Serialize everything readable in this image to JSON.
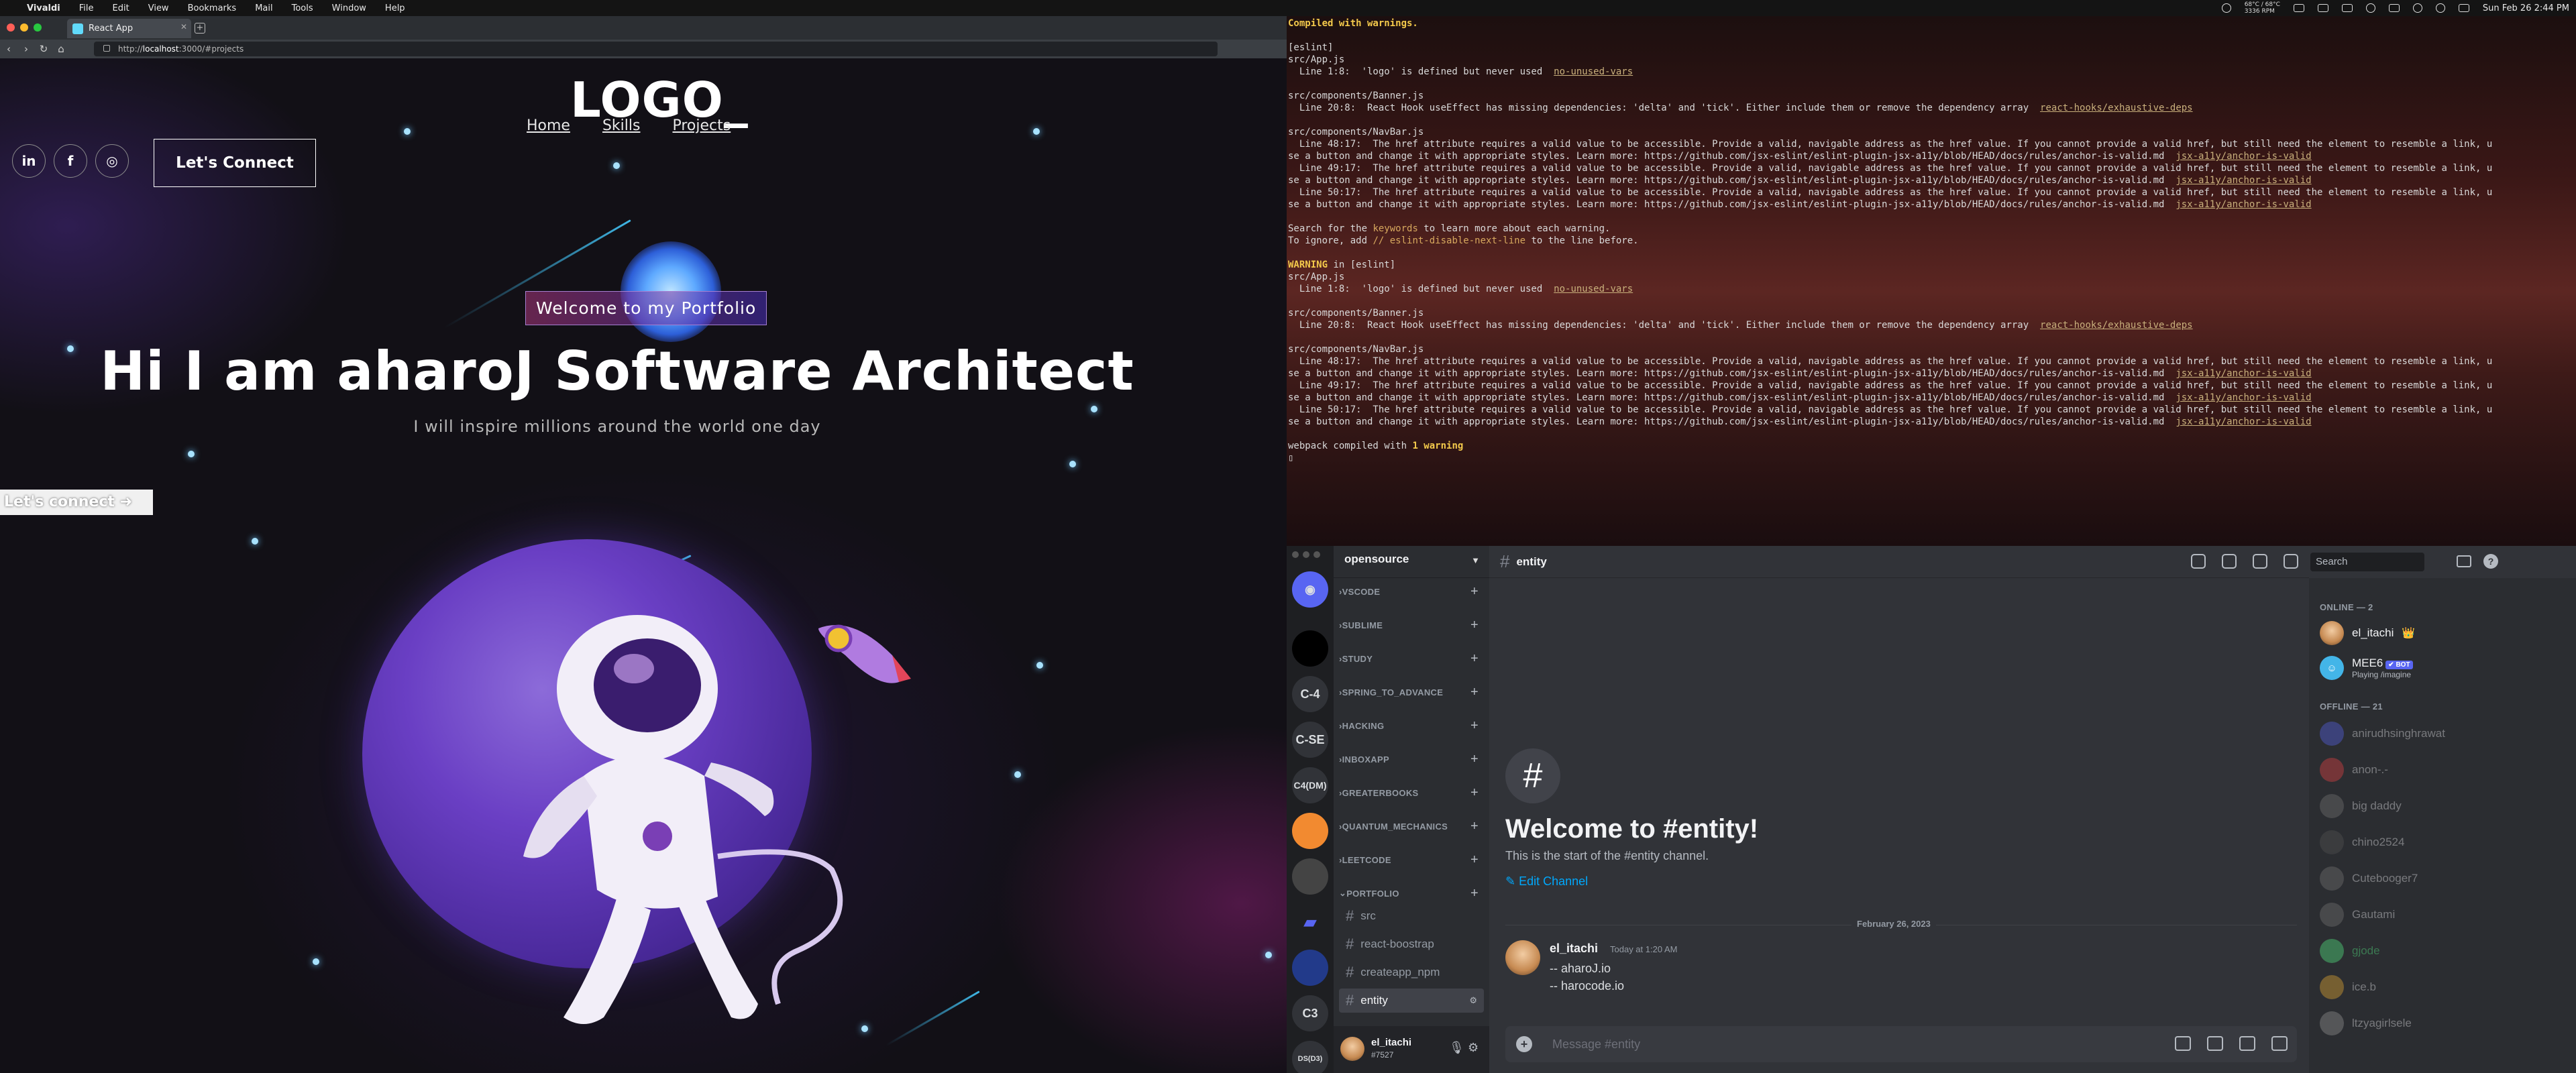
{
  "menubar": {
    "apple": "",
    "items": [
      "Vivaldi",
      "File",
      "Edit",
      "View",
      "Bookmarks",
      "Mail",
      "Tools",
      "Window",
      "Help"
    ],
    "temp": "68°C / 68°C",
    "rpm": "3336 RPM",
    "clock": "Sun Feb 26 2:44 PM"
  },
  "browser": {
    "tab_title": "React App",
    "new_tab": "+",
    "url_prefix": "http://",
    "url_host": "localhost",
    "url_rest": ":3000/#projects",
    "nav_back": "‹",
    "nav_forward": "›",
    "nav_reload": "↻",
    "nav_home": "⌂"
  },
  "portfolio": {
    "logo": "LOGO_",
    "nav": [
      "Home",
      "Skills",
      "Projects"
    ],
    "socials": [
      "in",
      "f",
      "◎"
    ],
    "connect_label": "Let's Connect",
    "tagline": "Welcome to my Portfolio",
    "headline": "Hi I am aharoJ Software Architect",
    "subline": "I will inspire millions around the world one day",
    "side_connect": "Let's connect ➜"
  },
  "terminal": {
    "lines": [
      [
        {
          "t": "Compiled with warnings.",
          "c": "ylw"
        }
      ],
      [
        {
          "t": ""
        }
      ],
      [
        {
          "t": "[eslint]"
        }
      ],
      [
        {
          "t": "src/App.js"
        }
      ],
      [
        {
          "t": "  Line 1:8:  'logo' is defined but never used  "
        },
        {
          "t": "no-unused-vars",
          "c": "rl"
        }
      ],
      [
        {
          "t": ""
        }
      ],
      [
        {
          "t": "src/components/Banner.js"
        }
      ],
      [
        {
          "t": "  Line 20:8:  React Hook useEffect has missing dependencies: 'delta' and 'tick'. Either include them or remove the dependency array  "
        },
        {
          "t": "react-hooks/exhaustive-deps",
          "c": "rl"
        }
      ],
      [
        {
          "t": ""
        }
      ],
      [
        {
          "t": "src/components/NavBar.js"
        }
      ],
      [
        {
          "t": "  Line 48:17:  The href attribute requires a valid value to be accessible. Provide a valid, navigable address as the href value. If you cannot provide a valid href, but still need the element to resemble a link, u"
        }
      ],
      [
        {
          "t": "se a button and change it with appropriate styles. Learn more: https://github.com/jsx-eslint/eslint-plugin-jsx-a11y/blob/HEAD/docs/rules/anchor-is-valid.md  "
        },
        {
          "t": "jsx-a11y/anchor-is-valid",
          "c": "rl"
        }
      ],
      [
        {
          "t": "  Line 49:17:  The href attribute requires a valid value to be accessible. Provide a valid, navigable address as the href value. If you cannot provide a valid href, but still need the element to resemble a link, u"
        }
      ],
      [
        {
          "t": "se a button and change it with appropriate styles. Learn more: https://github.com/jsx-eslint/eslint-plugin-jsx-a11y/blob/HEAD/docs/rules/anchor-is-valid.md  "
        },
        {
          "t": "jsx-a11y/anchor-is-valid",
          "c": "rl"
        }
      ],
      [
        {
          "t": "  Line 50:17:  The href attribute requires a valid value to be accessible. Provide a valid, navigable address as the href value. If you cannot provide a valid href, but still need the element to resemble a link, u"
        }
      ],
      [
        {
          "t": "se a button and change it with appropriate styles. Learn more: https://github.com/jsx-eslint/eslint-plugin-jsx-a11y/blob/HEAD/docs/rules/anchor-is-valid.md  "
        },
        {
          "t": "jsx-a11y/anchor-is-valid",
          "c": "rl"
        }
      ],
      [
        {
          "t": ""
        }
      ],
      [
        {
          "t": "Search for the "
        },
        {
          "t": "keywords",
          "c": "kw"
        },
        {
          "t": " to learn more about each warning."
        }
      ],
      [
        {
          "t": "To ignore, add "
        },
        {
          "t": "// eslint-disable-next-line",
          "c": "kw"
        },
        {
          "t": " to the line before."
        }
      ],
      [
        {
          "t": ""
        }
      ],
      [
        {
          "t": "WARNING",
          "c": "ylw"
        },
        {
          "t": " in [eslint]"
        }
      ],
      [
        {
          "t": "src/App.js"
        }
      ],
      [
        {
          "t": "  Line 1:8:  'logo' is defined but never used  "
        },
        {
          "t": "no-unused-vars",
          "c": "rl"
        }
      ],
      [
        {
          "t": ""
        }
      ],
      [
        {
          "t": "src/components/Banner.js"
        }
      ],
      [
        {
          "t": "  Line 20:8:  React Hook useEffect has missing dependencies: 'delta' and 'tick'. Either include them or remove the dependency array  "
        },
        {
          "t": "react-hooks/exhaustive-deps",
          "c": "rl"
        }
      ],
      [
        {
          "t": ""
        }
      ],
      [
        {
          "t": "src/components/NavBar.js"
        }
      ],
      [
        {
          "t": "  Line 48:17:  The href attribute requires a valid value to be accessible. Provide a valid, navigable address as the href value. If you cannot provide a valid href, but still need the element to resemble a link, u"
        }
      ],
      [
        {
          "t": "se a button and change it with appropriate styles. Learn more: https://github.com/jsx-eslint/eslint-plugin-jsx-a11y/blob/HEAD/docs/rules/anchor-is-valid.md  "
        },
        {
          "t": "jsx-a11y/anchor-is-valid",
          "c": "rl"
        }
      ],
      [
        {
          "t": "  Line 49:17:  The href attribute requires a valid value to be accessible. Provide a valid, navigable address as the href value. If you cannot provide a valid href, but still need the element to resemble a link, u"
        }
      ],
      [
        {
          "t": "se a button and change it with appropriate styles. Learn more: https://github.com/jsx-eslint/eslint-plugin-jsx-a11y/blob/HEAD/docs/rules/anchor-is-valid.md  "
        },
        {
          "t": "jsx-a11y/anchor-is-valid",
          "c": "rl"
        }
      ],
      [
        {
          "t": "  Line 50:17:  The href attribute requires a valid value to be accessible. Provide a valid, navigable address as the href value. If you cannot provide a valid href, but still need the element to resemble a link, u"
        }
      ],
      [
        {
          "t": "se a button and change it with appropriate styles. Learn more: https://github.com/jsx-eslint/eslint-plugin-jsx-a11y/blob/HEAD/docs/rules/anchor-is-valid.md  "
        },
        {
          "t": "jsx-a11y/anchor-is-valid",
          "c": "rl"
        }
      ],
      [
        {
          "t": ""
        }
      ],
      [
        {
          "t": "webpack compiled with "
        },
        {
          "t": "1 warning",
          "c": "ylw"
        }
      ],
      [
        {
          "t": "▯"
        }
      ]
    ]
  },
  "discord": {
    "server_name": "opensource",
    "servers": [
      "",
      "",
      "C-4",
      "C-SE",
      "C4(DM)",
      "",
      "",
      "",
      "",
      "C3",
      "DS(D3)"
    ],
    "categories": [
      "VSCODE",
      "SUBLIME",
      "STUDY",
      "SPRING_TO_ADVANCE",
      "HACKING",
      "INBOXAPP",
      "GREATERBOOKS",
      "QUANTUM_MECHANICS",
      "LEETCODE",
      "PORTFOLIO"
    ],
    "channels": [
      "src",
      "react-boostrap",
      "createapp_npm",
      "entity"
    ],
    "active_channel": "entity",
    "user_name": "el_itachi",
    "user_tag": "#7527",
    "welcome_title": "Welcome to #entity!",
    "welcome_sub": "This is the start of the #entity channel.",
    "edit_channel": "Edit Channel",
    "date_divider": "February 26, 2023",
    "message": {
      "author": "el_itachi",
      "time": "Today at 1:20 AM",
      "lines": [
        "--   aharoJ.io",
        "--   harocode.io"
      ]
    },
    "composer_placeholder": "Message #entity",
    "search_placeholder": "Search",
    "online_header": "ONLINE — 2",
    "online": [
      {
        "name": "el_itachi",
        "extra": "👑",
        "color": "#f2f3f5"
      },
      {
        "name": "MEE6",
        "bot": "✔ BOT",
        "status": "Playing /imagine",
        "color": "#f2f3f5"
      }
    ],
    "offline_header": "OFFLINE — 21",
    "offline": [
      {
        "name": "anirudhsinghrawat",
        "color": "#f2f3f5"
      },
      {
        "name": "anon-.-",
        "color": "#f2f3f5"
      },
      {
        "name": "big daddy",
        "color": "#f2f3f5"
      },
      {
        "name": "chino2524",
        "color": "#f2f3f5"
      },
      {
        "name": "Cutebooger7",
        "color": "#f2f3f5"
      },
      {
        "name": "Gautami",
        "color": "#f2f3f5"
      },
      {
        "name": "gjode",
        "color": "#57f287"
      },
      {
        "name": "ice.b",
        "color": "#f2f3f5"
      },
      {
        "name": "ltzyagirlsele",
        "color": "#f2f3f5"
      }
    ]
  },
  "colors": {
    "accent": "#00a8fc",
    "discord_bg": "#313338",
    "terminal_warning": "#f3c94b"
  }
}
